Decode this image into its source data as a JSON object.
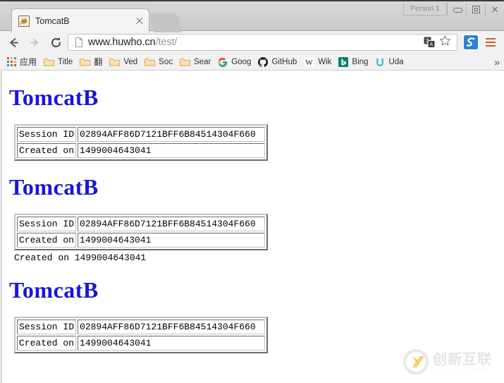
{
  "window": {
    "person_label": "Person 1",
    "minimize_icon": "minimize-icon",
    "maximize_icon": "maximize-icon",
    "close_label": "✕"
  },
  "tab": {
    "title": "TomcatB",
    "favicon": "tomcat-favicon",
    "close_label": "",
    "newtab_label": ""
  },
  "toolbar": {
    "back_icon": "back-arrow-icon",
    "forward_icon": "forward-arrow-icon",
    "reload_icon": "reload-icon",
    "page_icon": "page-document-icon",
    "url_host": "www.huwho.cn",
    "url_path": "/test/",
    "translate_icon": "translate-icon",
    "star_icon": "star-bookmark-icon",
    "extension_icon": "sogou-extension-icon",
    "menu_icon": "chrome-menu-icon"
  },
  "bookmarks": {
    "apps_label": "应用",
    "items": [
      {
        "label": "Title",
        "icon": "folder-icon"
      },
      {
        "label": "翻",
        "icon": "folder-icon"
      },
      {
        "label": "Ved",
        "icon": "folder-icon"
      },
      {
        "label": "Soc",
        "icon": "folder-icon"
      },
      {
        "label": "Sear",
        "icon": "folder-icon"
      },
      {
        "label": "Goog",
        "icon": "google-icon"
      },
      {
        "label": "GitHub",
        "icon": "github-icon"
      },
      {
        "label": "Wik",
        "icon": "wikipedia-icon"
      },
      {
        "label": "Bing",
        "icon": "bing-icon"
      },
      {
        "label": "Uda",
        "icon": "udacity-icon"
      }
    ],
    "overflow_label": "»"
  },
  "page": {
    "heading": "TomcatB",
    "session_label": "Session ID",
    "created_label": "Created on",
    "session_id": "02894AFF86D7121BFF6B84514304F660",
    "created_on": "1499004643041",
    "extra_created_line": "Created on 1499004643041",
    "heading_color": "#1a14d8",
    "sections": [
      {
        "has_extra_line": false
      },
      {
        "has_extra_line": true
      },
      {
        "has_extra_line": false
      }
    ]
  },
  "watermark": {
    "text": "创新互联",
    "subtext": "C H E N G D U  C R E A T E N E T",
    "logo_icon": "createnet-logo-icon"
  }
}
